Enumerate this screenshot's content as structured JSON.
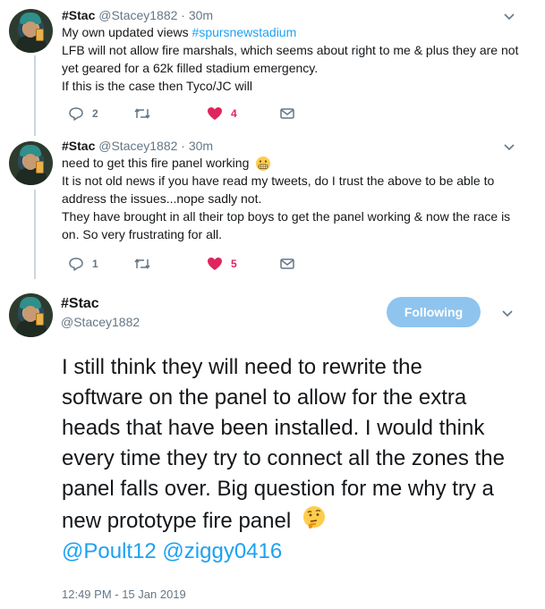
{
  "tweets": [
    {
      "name": "#Stac",
      "handle": "@Stacey1882",
      "dot": "·",
      "time": "30m",
      "line1_prefix": "My own updated views ",
      "line1_hashtag": "#spursnewstadium",
      "line2": "LFB will not allow fire marshals, which seems about right to me & plus they are not yet geared for a 62k filled stadium emergency.",
      "line3": "If this is the case then Tyco/JC will",
      "replies": "2",
      "likes": "4"
    },
    {
      "name": "#Stac",
      "handle": "@Stacey1882",
      "dot": "·",
      "time": "30m",
      "line1": "need to get this fire panel working",
      "line2": "It is not old news if you have read my tweets, do I trust the above to be able to address the issues...nope sadly not.",
      "line3": "They have brought in all their top boys to get the panel working & now the race is on. So very frustrating for all.",
      "replies": "1",
      "likes": "5"
    }
  ],
  "main": {
    "name": "#Stac",
    "handle": "@Stacey1882",
    "follow_label": "Following",
    "text": "I still think they will need to rewrite the software on the panel to allow for the extra heads that have been installed. I would think every time they try to connect all the zones the panel falls over. Big question for me why try a new prototype fire panel",
    "mentions": "@Poult12 @ziggy0416",
    "timestamp": "12:49 PM - 15 Jan 2019"
  },
  "colors": {
    "link": "#1da1f2",
    "like": "#e0245e",
    "muted": "#657786",
    "follow_bg": "#8ec4ee"
  },
  "icons": [
    "reply-icon",
    "retweet-icon",
    "heart-icon",
    "dm-icon",
    "chevron-down-icon",
    "grimacing-emoji",
    "thinking-emoji"
  ]
}
